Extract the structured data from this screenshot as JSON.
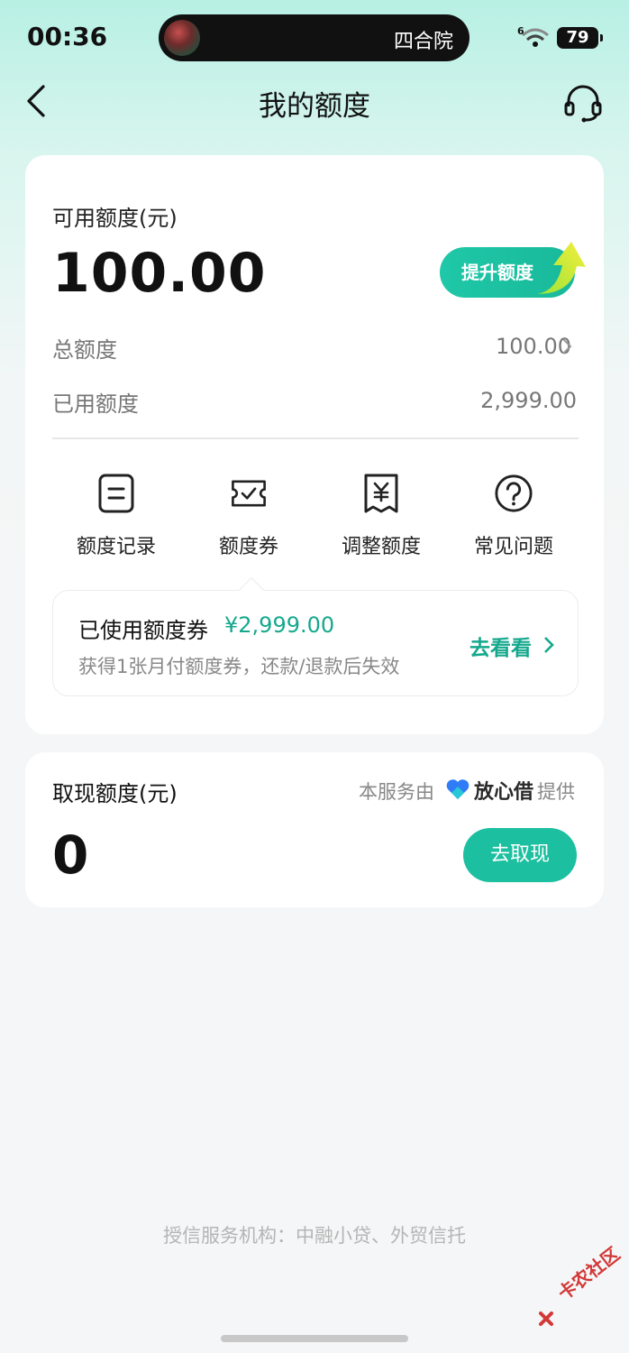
{
  "status_bar": {
    "time": "00:36",
    "now_playing": "四合院",
    "network": "6",
    "battery": "79"
  },
  "nav": {
    "title": "我的额度",
    "back_icon": "chevron-left-icon",
    "service_icon": "headset-icon"
  },
  "credit": {
    "available_label": "可用额度(元)",
    "available_amount": "100.00",
    "raise_button": "提升额度",
    "total_label": "总额度",
    "total_value": "100.00",
    "used_label": "已用额度",
    "used_value": "2,999.00"
  },
  "shortcuts": [
    {
      "label": "额度记录",
      "icon": "record-icon"
    },
    {
      "label": "额度券",
      "icon": "ticket-icon"
    },
    {
      "label": "调整额度",
      "icon": "yuan-receipt-icon"
    },
    {
      "label": "常见问题",
      "icon": "question-icon"
    }
  ],
  "voucher": {
    "title": "已使用额度券",
    "amount": "¥2,999.00",
    "description": "获得1张月付额度券，还款/退款后失效",
    "link": "去看看"
  },
  "cash": {
    "label": "取现额度(元)",
    "provider_prefix": "本服务由",
    "provider_name": "放心借",
    "provider_suffix": "提供",
    "amount": "0",
    "button": "去取现"
  },
  "footer": {
    "note": "授信服务机构：中融小贷、外贸信托"
  },
  "watermark": "卡农社区",
  "colors": {
    "accent": "#1cbf9f",
    "accent_text": "#15a88d",
    "header_gradient_top": "#b8f0e4",
    "background": "#f5f6f7"
  }
}
